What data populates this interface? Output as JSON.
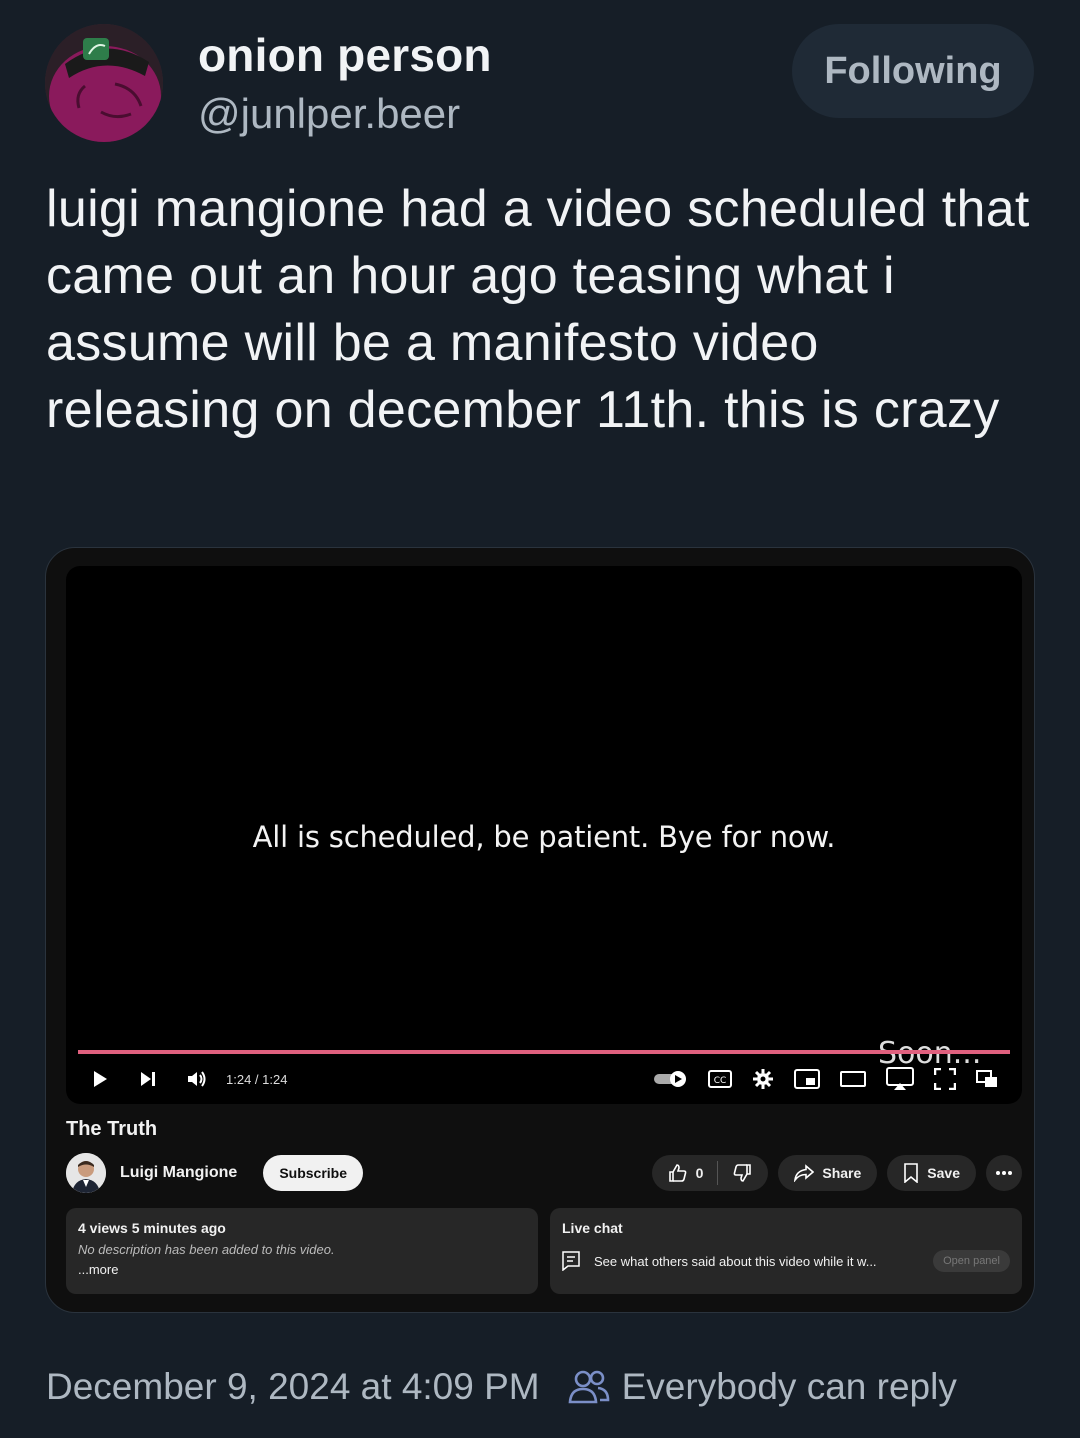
{
  "author": {
    "display_name": "onion person",
    "handle": "@junlper.beer"
  },
  "follow_button": {
    "label": "Following"
  },
  "post": {
    "text": "luigi mangione had a video scheduled that came out an hour ago teasing what i assume will be a manifesto video releasing on december 11th.  this is crazy"
  },
  "embed": {
    "video": {
      "caption": "All is scheduled, be patient. Bye for now.",
      "overlay_text": "Soon...",
      "time": "1:24 / 1:24",
      "progress": 1.0
    },
    "title": "The Truth",
    "channel": {
      "name": "Luigi Mangione",
      "subscribe_label": "Subscribe"
    },
    "actions": {
      "like_count": "0",
      "share_label": "Share",
      "save_label": "Save"
    },
    "description": {
      "stats": "4 views  5 minutes ago",
      "text": "No description has been added to this video.",
      "more": "...more"
    },
    "live_chat": {
      "title": "Live chat",
      "text": "See what others said about this video while it w...",
      "open_panel_label": "Open panel"
    }
  },
  "footer": {
    "timestamp": "December 9, 2024 at 4:09 PM",
    "reply_setting": "Everybody can reply"
  },
  "colors": {
    "background": "#161e27",
    "progress": "#e0607e",
    "avatar_accent": "#8a1a5c"
  }
}
